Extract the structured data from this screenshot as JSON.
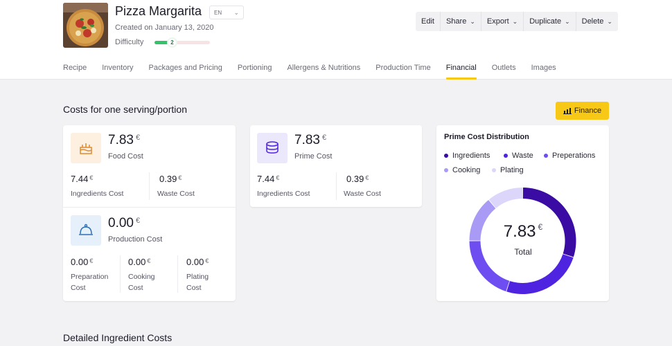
{
  "recipe": {
    "title": "Pizza Margarita",
    "language": "EN",
    "created": "Created on January 13, 2020",
    "difficulty_label": "Difficulty",
    "difficulty_value": "2",
    "difficulty_fraction": 0.4
  },
  "actions": [
    {
      "label": "Edit",
      "dropdown": false
    },
    {
      "label": "Share",
      "dropdown": true
    },
    {
      "label": "Export",
      "dropdown": true
    },
    {
      "label": "Duplicate",
      "dropdown": true
    },
    {
      "label": "Delete",
      "dropdown": true
    }
  ],
  "tabs": [
    {
      "label": "Recipe",
      "active": false
    },
    {
      "label": "Inventory",
      "active": false
    },
    {
      "label": "Packages and Pricing",
      "active": false
    },
    {
      "label": "Portioning",
      "active": false
    },
    {
      "label": "Allergens & Nutritions",
      "active": false
    },
    {
      "label": "Production Time",
      "active": false
    },
    {
      "label": "Financial",
      "active": true
    },
    {
      "label": "Outlets",
      "active": false
    },
    {
      "label": "Images",
      "active": false
    }
  ],
  "section": {
    "title": "Costs for one serving/portion",
    "finance_button": "Finance"
  },
  "currency": "€",
  "food_cost": {
    "value": "7.83",
    "label": "Food Cost",
    "ingredients_value": "7.44",
    "ingredients_label": "Ingredients Cost",
    "waste_value": "0.39",
    "waste_label": "Waste Cost"
  },
  "production_cost": {
    "value": "0.00",
    "label": "Production Cost",
    "items": [
      {
        "value": "0.00",
        "label_line1": "Preparation",
        "label_line2": "Cost"
      },
      {
        "value": "0.00",
        "label_line1": "Cooking",
        "label_line2": "Cost"
      },
      {
        "value": "0.00",
        "label_line1": "Plating",
        "label_line2": "Cost"
      }
    ]
  },
  "prime_cost": {
    "value": "7.83",
    "label": "Prime Cost",
    "ingredients_value": "7.44",
    "ingredients_label": "Ingredients Cost",
    "waste_value": "0.39",
    "waste_label": "Waste Cost"
  },
  "distribution": {
    "title": "Prime Cost Distribution",
    "legend": [
      {
        "name": "Ingredients",
        "color": "#3a0ca3"
      },
      {
        "name": "Waste",
        "color": "#4f24e0"
      },
      {
        "name": "Preperations",
        "color": "#6e4ef0"
      },
      {
        "name": "Cooking",
        "color": "#a99af5"
      },
      {
        "name": "Plating",
        "color": "#dcd6fb"
      }
    ],
    "segments": [
      {
        "name": "Ingredients",
        "fraction": 0.3,
        "color": "#3a0ca3"
      },
      {
        "name": "Waste",
        "fraction": 0.25,
        "color": "#4f24e0"
      },
      {
        "name": "Preperations",
        "fraction": 0.2,
        "color": "#6e4ef0"
      },
      {
        "name": "Cooking",
        "fraction": 0.14,
        "color": "#a99af5"
      },
      {
        "name": "Plating",
        "fraction": 0.11,
        "color": "#dcd6fb"
      }
    ],
    "total_value": "7.83",
    "total_label": "Total"
  },
  "detailed": {
    "title": "Detailed Ingredient Costs"
  }
}
